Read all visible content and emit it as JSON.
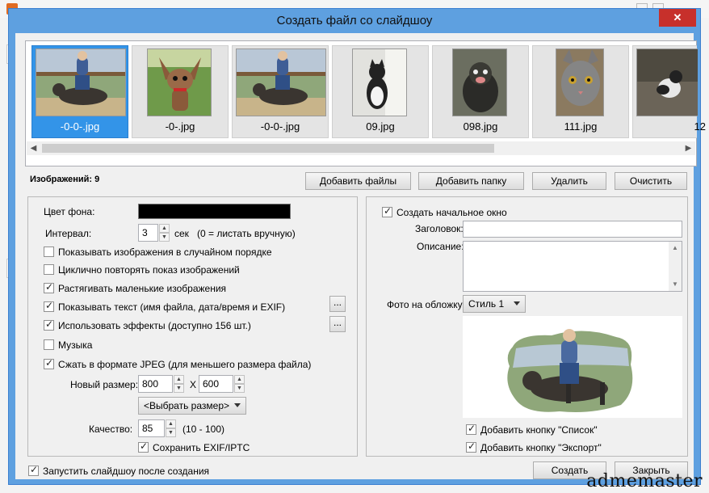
{
  "dialog": {
    "title": "Создать файл со слайдшоу",
    "close_label": "✕"
  },
  "thumbnails": [
    {
      "caption": "-0-0-.jpg",
      "selected": true
    },
    {
      "caption": "-0-.jpg",
      "selected": false
    },
    {
      "caption": "-0-0-.jpg",
      "selected": false
    },
    {
      "caption": "09.jpg",
      "selected": false
    },
    {
      "caption": "098.jpg",
      "selected": false
    },
    {
      "caption": "111.jpg",
      "selected": false
    },
    {
      "caption": "12",
      "selected": false
    }
  ],
  "toolbar": {
    "image_count": "Изображений: 9",
    "add_files": "Добавить файлы",
    "add_folder": "Добавить папку",
    "delete": "Удалить",
    "clear": "Очистить"
  },
  "left": {
    "bg_color_label": "Цвет фона:",
    "bg_color": "#000000",
    "interval_label": "Интервал:",
    "interval_value": "3",
    "interval_unit": "сек",
    "interval_note": "(0 = листать вручную)",
    "random": {
      "label": "Показывать изображения в случайном порядке",
      "checked": false
    },
    "loop": {
      "label": "Циклично повторять показ изображений",
      "checked": false
    },
    "stretch": {
      "label": "Растягивать маленькие изображения",
      "checked": true
    },
    "show_text": {
      "label": "Показывать текст (имя файла, дата/время и EXIF)",
      "checked": true
    },
    "effects": {
      "label": "Использовать эффекты (доступно 156 шт.)",
      "checked": true
    },
    "music": {
      "label": "Музыка",
      "checked": false
    },
    "jpeg": {
      "label": "Сжать в формате JPEG (для меньшего размера файла)",
      "checked": true
    },
    "ellipsis": "...",
    "new_size_label": "Новый размер:",
    "width": "800",
    "x_sep": "X",
    "height": "600",
    "size_select": "<Выбрать размер>",
    "quality_label": "Качество:",
    "quality_value": "85",
    "quality_range": "(10 - 100)",
    "keep_exif": {
      "label": "Сохранить EXIF/IPTC",
      "checked": true
    }
  },
  "right": {
    "create_start": {
      "label": "Создать начальное окно",
      "checked": true
    },
    "title_label": "Заголовок:",
    "title_value": "",
    "desc_label": "Описание:",
    "cover_label": "Фото на обложку:",
    "cover_style": "Стиль 1",
    "add_list_btn": {
      "label": "Добавить кнопку \"Список\"",
      "checked": true
    },
    "add_export_btn": {
      "label": "Добавить кнопку \"Экспорт\"",
      "checked": true
    }
  },
  "footer": {
    "run_after": {
      "label": "Запустить слайдшоу после создания",
      "checked": true
    },
    "create": "Создать",
    "close": "Закрыть"
  },
  "watermark": "admemaster"
}
